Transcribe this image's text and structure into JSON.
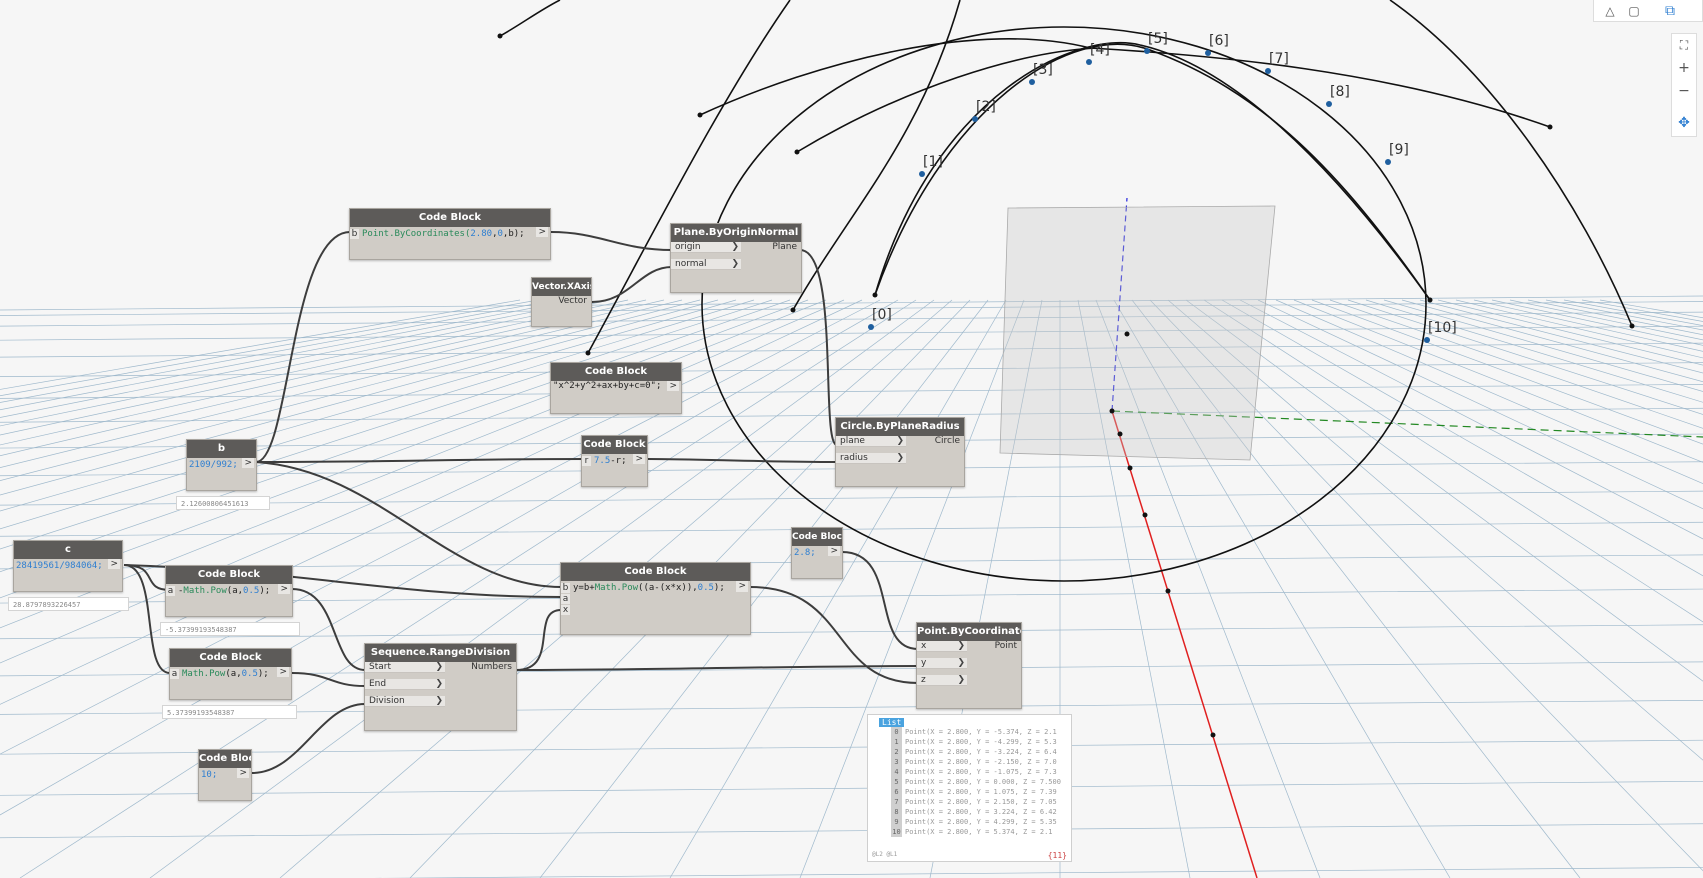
{
  "nodes": {
    "cb_point": {
      "title": "Code Block",
      "pin": "b",
      "code_fn": "Point.ByCoordinates(",
      "code_num1": "2.80",
      "code_sep1": ",",
      "code_num2": "0",
      "code_rest": ",b);"
    },
    "plane": {
      "title": "Plane.ByOriginNormal",
      "in1": "origin",
      "in2": "normal",
      "out": "Plane"
    },
    "vector": {
      "title": "Vector.XAxis",
      "out": "Vector"
    },
    "cb_string": {
      "title": "Code Block",
      "code": "\"x^2+y^2+ax+by+c=0\";"
    },
    "circle": {
      "title": "Circle.ByPlaneRadius",
      "in1": "plane",
      "in2": "radius",
      "out": "Circle"
    },
    "cb_r": {
      "title": "Code Block",
      "pin": "r",
      "code_num": "7.5",
      "code_rest": "-r;"
    },
    "b": {
      "title": "b",
      "code": "2109/992;",
      "preview": "2.12600806451613"
    },
    "c": {
      "title": "c",
      "code": "28419561/984064;",
      "preview": "28.8797893226457"
    },
    "cb_neg": {
      "title": "Code Block",
      "pin": "a",
      "code_pre": "-",
      "code_fn": "Math.Pow",
      "code_mid": "(a,",
      "code_num": "0.5",
      "code_end": ");",
      "preview": "-5.37399193548387"
    },
    "cb_pos": {
      "title": "Code Block",
      "pin": "a",
      "code_fn": "Math.Pow",
      "code_mid": "(a,",
      "code_num": "0.5",
      "code_end": ");",
      "preview": "5.37399193548387"
    },
    "cb_ten": {
      "title": "Code Block",
      "code": "10;"
    },
    "seq": {
      "title": "Sequence.RangeDivision",
      "in1": "Start",
      "in2": "End",
      "in3": "Division",
      "out": "Numbers"
    },
    "cb_y": {
      "title": "Code Block",
      "pins": [
        "b",
        "a",
        "x"
      ],
      "code_a": "y=b+",
      "code_fn": "Math.Pow",
      "code_b": "((a-(x*x)),",
      "code_num": "0.5",
      "code_c": ");"
    },
    "cb_28": {
      "title": "Code Block",
      "code": "2.8;"
    },
    "point": {
      "title": "Point.ByCoordinates",
      "in1": "x",
      "in2": "y",
      "in3": "z",
      "out": "Point"
    }
  },
  "watch": {
    "tag": "List",
    "items": [
      {
        "i": "0",
        "text": "Point(X = 2.800, Y = -5.374, Z = 2.1"
      },
      {
        "i": "1",
        "text": "Point(X = 2.800, Y = -4.299, Z = 5.3"
      },
      {
        "i": "2",
        "text": "Point(X = 2.800, Y = -3.224, Z = 6.4"
      },
      {
        "i": "3",
        "text": "Point(X = 2.800, Y = -2.150, Z = 7.0"
      },
      {
        "i": "4",
        "text": "Point(X = 2.800, Y = -1.075, Z = 7.3"
      },
      {
        "i": "5",
        "text": "Point(X = 2.800, Y = 0.000, Z = 7.500"
      },
      {
        "i": "6",
        "text": "Point(X = 2.800, Y = 1.075, Z = 7.39"
      },
      {
        "i": "7",
        "text": "Point(X = 2.800, Y = 2.150, Z = 7.05"
      },
      {
        "i": "8",
        "text": "Point(X = 2.800, Y = 3.224, Z = 6.42"
      },
      {
        "i": "9",
        "text": "Point(X = 2.800, Y = 4.299, Z = 5.35"
      },
      {
        "i": "10",
        "text": "Point(X = 2.800, Y = 5.374, Z = 2.1"
      }
    ],
    "footer_left": "@L2 @L1",
    "count": "{11}"
  },
  "point_labels": [
    "[0]",
    "[1]",
    "[2]",
    "[3]",
    "[4]",
    "[5]",
    "[6]",
    "[7]",
    "[8]",
    "[9]",
    "[10]"
  ],
  "toolbar": {
    "zoom_fit_icon": "⛶",
    "zoom_in": "+",
    "zoom_out": "−",
    "pan_icon": "✥"
  },
  "colors": {
    "node_header": "#5d5b59",
    "node_body": "#d0ccc6",
    "axis_red": "#e02020",
    "axis_blue": "#2222dd",
    "axis_green": "#228822",
    "point_blue": "#1f5f9f"
  }
}
